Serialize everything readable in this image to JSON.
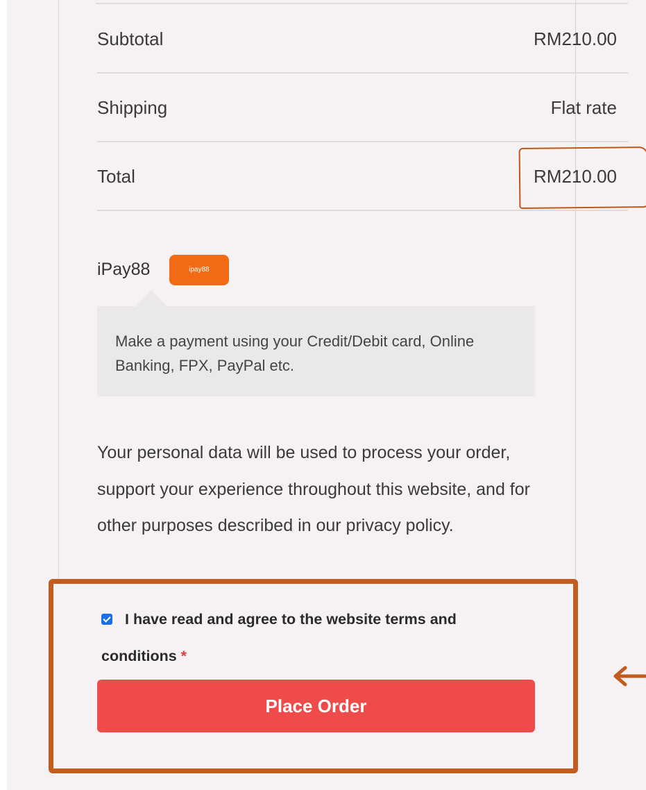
{
  "summary": {
    "subtotal_label": "Subtotal",
    "subtotal_value": "RM210.00",
    "shipping_label": "Shipping",
    "shipping_value": "Flat rate",
    "total_label": "Total",
    "total_value": "RM210.00"
  },
  "payment": {
    "method_label": "iPay88",
    "badge_text": "ipay88",
    "description": "Make a payment using your Credit/Debit card, Online Banking, FPX, PayPal etc."
  },
  "privacy_text": "Your personal data will be used to process your order, support your experience throughout this website, and for other purposes described in our privacy policy.",
  "terms": {
    "checked": true,
    "label": "I have read and agree to the website terms and conditions",
    "required_mark": "*"
  },
  "place_order_label": "Place Order",
  "colors": {
    "button": "#ef4b4b",
    "annotation": "#c05d1e",
    "badge": "#f26a14",
    "checkbox": "#1a6ee8"
  },
  "annotations": {
    "arrow_icon": "left-arrow-icon"
  }
}
